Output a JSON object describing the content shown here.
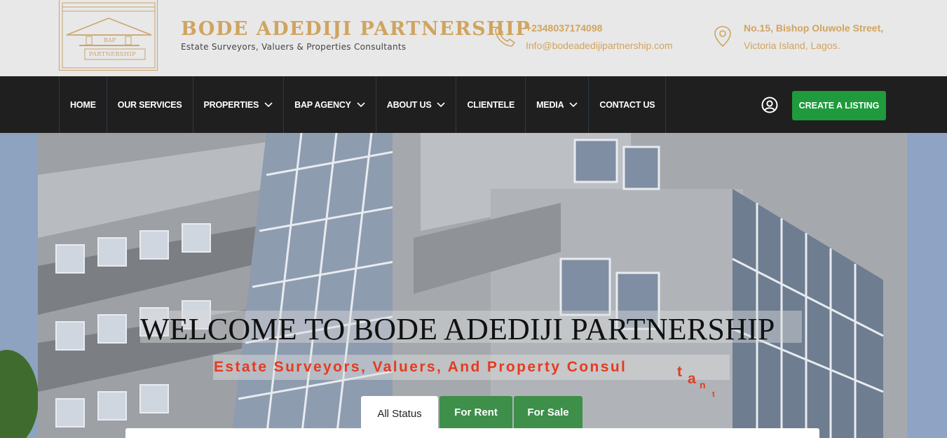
{
  "brand": {
    "name": "BODE ADEDIJI PARTNERSHIP",
    "tagline": "Estate Surveyors, Valuers & Properties Consultants",
    "logo_text_top": "BAP",
    "logo_text_bottom": "PARTNERSHIP"
  },
  "contact": {
    "phone": "+2348037174098",
    "email": "Info@bodeadedijipartnership.com",
    "address_line1": "No.15, Bishop Oluwole Street,",
    "address_line2": "Victoria Island, Lagos."
  },
  "nav": {
    "items": [
      {
        "label": "HOME",
        "dropdown": false
      },
      {
        "label": "OUR SERVICES",
        "dropdown": false
      },
      {
        "label": "PROPERTIES",
        "dropdown": true
      },
      {
        "label": "BAP AGENCY",
        "dropdown": true
      },
      {
        "label": "ABOUT US",
        "dropdown": true
      },
      {
        "label": "CLIENTELE",
        "dropdown": false
      },
      {
        "label": "MEDIA",
        "dropdown": true
      },
      {
        "label": "CONTACT US",
        "dropdown": false
      }
    ],
    "create_listing": "CREATE A LISTING"
  },
  "hero": {
    "title": "WELCOME TO BODE ADEDIJI PARTNERSHIP",
    "subtitle": "Estate Surveyors, Valuers, And Property Consul",
    "subtitle_tail": [
      "t",
      "a",
      "n",
      "t"
    ]
  },
  "search": {
    "tabs": [
      "All Status",
      "For Rent",
      "For Sale"
    ],
    "active_tab": "All Status"
  },
  "colors": {
    "gold": "#d0a45f",
    "nav_bg": "#1f1f1f",
    "green": "#1f9a3c",
    "tab_green": "#3d8f4a",
    "subtitle_red": "#e63a1f"
  },
  "icons": {
    "phone": "phone-icon",
    "location": "map-pin-icon",
    "user": "user-circle-icon",
    "chevron": "chevron-down-icon"
  }
}
